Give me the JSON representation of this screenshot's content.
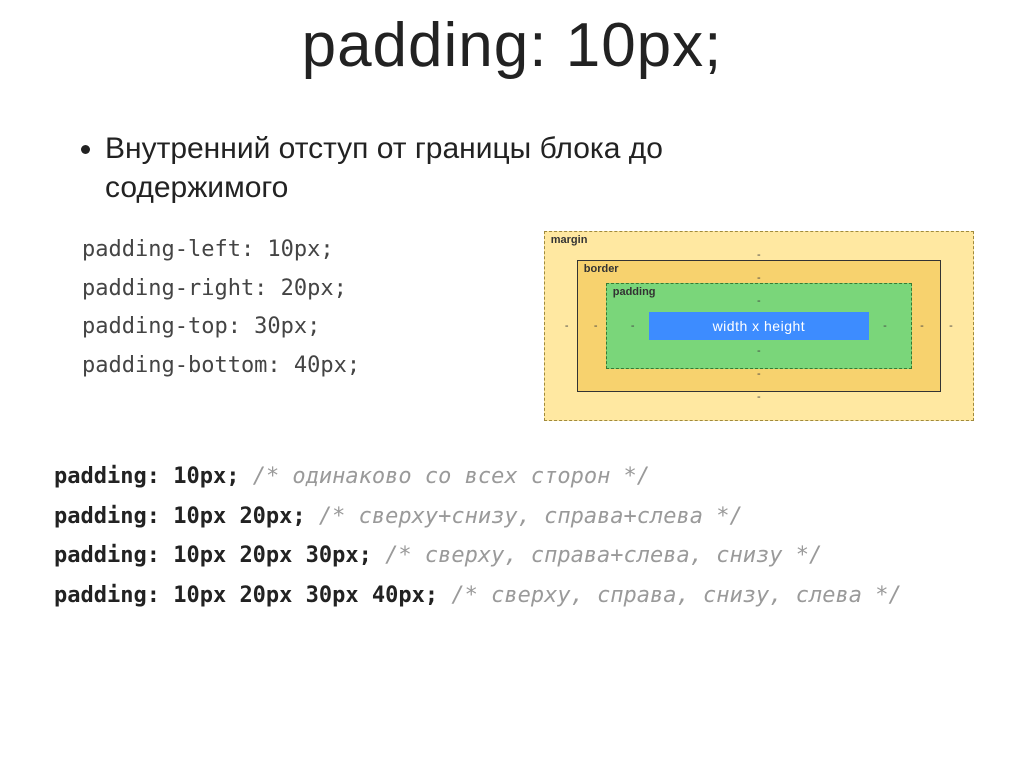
{
  "title": "padding: 10px;",
  "bullet": "Внутренний отступ от границы блока до содержимого",
  "code_individual": {
    "l1": "padding-left: 10px;",
    "l2": "padding-right: 20px;",
    "l3": "padding-top: 30px;",
    "l4": "padding-bottom: 40px;"
  },
  "box_model": {
    "margin_label": "margin",
    "border_label": "border",
    "padding_label": "padding",
    "content_label": "width x height",
    "dash": "-"
  },
  "shorthand": {
    "kw": "padding:",
    "r1": {
      "vals": " 10px;",
      "cmt": " /* одинаково со всех сторон */"
    },
    "r2": {
      "vals": " 10px 20px;",
      "cmt": " /* сверху+снизу, справа+слева */"
    },
    "r3": {
      "vals": " 10px 20px 30px;",
      "cmt": " /* сверху, справа+слева, снизу */"
    },
    "r4": {
      "vals": " 10px 20px 30px 40px;",
      "cmt": " /* сверху, справа, снизу, слева */"
    }
  }
}
